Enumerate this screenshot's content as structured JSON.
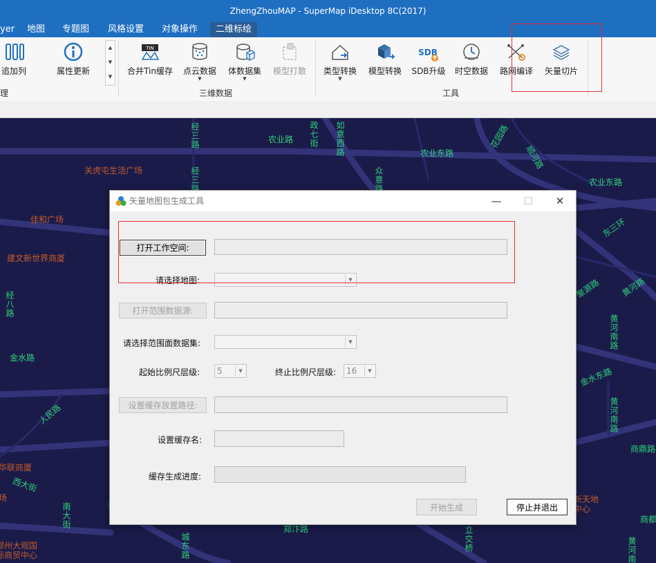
{
  "window": {
    "title": "ZhengZhouMAP - SuperMap iDesktop 8C(2017)"
  },
  "menu": {
    "partial_left": "yer",
    "tabs": [
      "地图",
      "专题图",
      "风格设置",
      "对象操作",
      "二维标绘"
    ]
  },
  "ribbon": {
    "left_buttons": {
      "add_column": "追加列",
      "attr_update": "属性更新"
    },
    "left_group_partial": "理",
    "group_3d": {
      "label": "三维数据",
      "buttons": [
        "合并Tin缓存",
        "点云数据",
        "体数据集",
        "模型打散"
      ]
    },
    "group_tools": {
      "label": "工具",
      "buttons": [
        "类型转换",
        "模型转换",
        "SDB升级",
        "时空数据",
        "路网编译",
        "矢量切片"
      ]
    }
  },
  "map": {
    "roads": [
      "农业路",
      "农业东路",
      "农业东路",
      "经三路",
      "经三路",
      "经八路",
      "金水路",
      "人民路",
      "西大街",
      "南大街",
      "城东路",
      "郑汴路",
      "金水东路",
      "黄河南路",
      "黄河南路",
      "黄河南路",
      "黄河路",
      "商鼎路",
      "商都路",
      "聚源路",
      "如意西路",
      "政七街",
      "花园路",
      "众意路",
      "顺河路",
      "立交桥",
      "东三环"
    ],
    "pois": [
      "关虎屯生活广场",
      "佳和广场",
      "建文新世界商厦",
      "华联商厦",
      "场",
      "郑州大观国际商贸中心",
      "新天地中心"
    ]
  },
  "dialog": {
    "title": "矢量地图包生成工具",
    "open_workspace": "打开工作空间:",
    "select_map": "请选择地图:",
    "open_range_ds": "打开范围数据源:",
    "select_range_dataset": "请选择范围面数据集:",
    "start_level_label": "起始比例尺层级:",
    "start_level_value": "5",
    "end_level_label": "终止比例尺层级:",
    "end_level_value": "16",
    "set_cache_path": "设置缓存放置路径:",
    "set_cache_name": "设置缓存名:",
    "progress_label": "缓存生成进度:",
    "start_btn": "开始生成",
    "stop_btn": "停止并退出",
    "win_min": "—",
    "win_max": "☐",
    "win_close": "✕"
  },
  "colors": {
    "titlebar": "#1f6fc1",
    "map_bg": "#1b1b4a",
    "road_label": "#2fd07a",
    "poi_label": "#c45a28",
    "highlight": "#e0312f"
  }
}
